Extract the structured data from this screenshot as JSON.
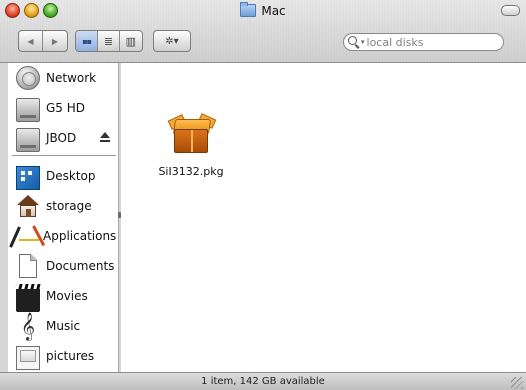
{
  "window": {
    "title": "Mac"
  },
  "toolbar": {
    "back_label": "◀",
    "forward_label": "▶",
    "view_icon_label": "▪▪",
    "view_list_label": "≣",
    "view_column_label": "▥",
    "action_label": "✲▾",
    "search": {
      "placeholder": "local disks",
      "value": ""
    }
  },
  "sidebar": {
    "devices": [
      {
        "label": "Network",
        "icon": "network-icon"
      },
      {
        "label": "G5 HD",
        "icon": "hard-drive-icon"
      },
      {
        "label": "JBOD",
        "icon": "hard-drive-icon"
      }
    ],
    "places": [
      {
        "label": "Desktop",
        "icon": "desktop-icon"
      },
      {
        "label": "storage",
        "icon": "home-icon"
      },
      {
        "label": "Applications",
        "icon": "applications-icon"
      },
      {
        "label": "Documents",
        "icon": "documents-icon"
      },
      {
        "label": "Movies",
        "icon": "movies-icon"
      },
      {
        "label": "Music",
        "icon": "music-icon"
      },
      {
        "label": "pictures",
        "icon": "pictures-icon"
      }
    ],
    "music_glyph": "𝄞"
  },
  "content": {
    "items": [
      {
        "name": "SiI3132.pkg",
        "icon": "package-icon"
      }
    ]
  },
  "status": {
    "text": "1 item, 142 GB available"
  }
}
